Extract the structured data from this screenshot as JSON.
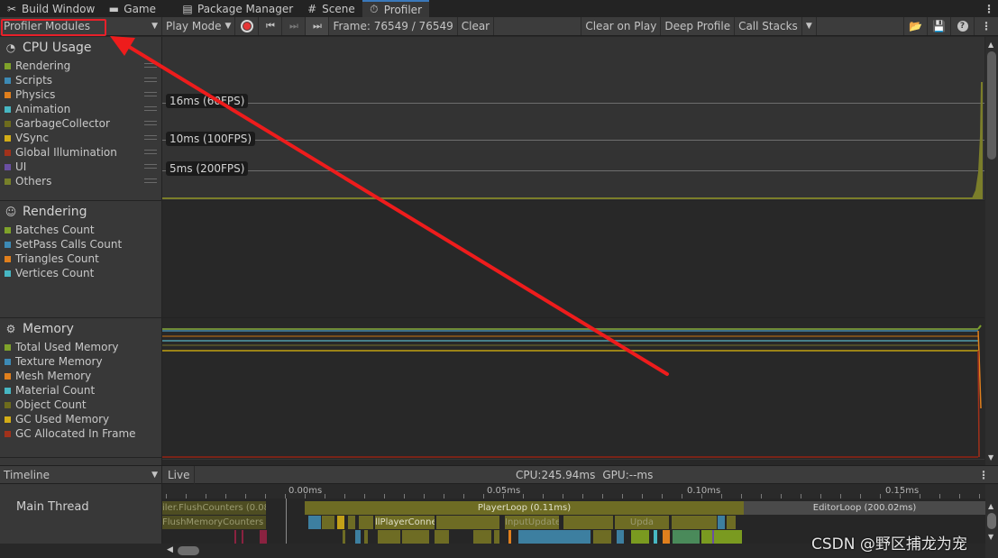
{
  "tabs": [
    {
      "label": "Build Window",
      "icon": "tools-icon"
    },
    {
      "label": "Game",
      "icon": "gamepad-icon"
    },
    {
      "label": "Package Manager",
      "icon": "package-icon"
    },
    {
      "label": "Scene",
      "icon": "hash-icon"
    },
    {
      "label": "Profiler",
      "icon": "stopwatch-icon",
      "active": true
    }
  ],
  "toolbar": {
    "modules_label": "Profiler Modules",
    "play_mode_label": "Play Mode",
    "frame_label": "Frame: 76549 / 76549",
    "clear_label": "Clear",
    "clear_on_play_label": "Clear on Play",
    "deep_profile_label": "Deep Profile",
    "call_stacks_label": "Call Stacks"
  },
  "modules": {
    "cpu": {
      "title": "CPU Usage",
      "items": [
        {
          "label": "Rendering",
          "color": "#7fa22a"
        },
        {
          "label": "Scripts",
          "color": "#3d8ab5"
        },
        {
          "label": "Physics",
          "color": "#e07f1d"
        },
        {
          "label": "Animation",
          "color": "#47b7c3"
        },
        {
          "label": "GarbageCollector",
          "color": "#6e6c1d"
        },
        {
          "label": "VSync",
          "color": "#d2ac17"
        },
        {
          "label": "Global Illumination",
          "color": "#a1311b"
        },
        {
          "label": "UI",
          "color": "#6a4fa3"
        },
        {
          "label": "Others",
          "color": "#77802a"
        }
      ],
      "fps_markers": [
        "16ms (60FPS)",
        "10ms (100FPS)",
        "5ms (200FPS)"
      ]
    },
    "rendering": {
      "title": "Rendering",
      "items": [
        {
          "label": "Batches Count",
          "color": "#7fa22a"
        },
        {
          "label": "SetPass Calls Count",
          "color": "#3d8ab5"
        },
        {
          "label": "Triangles Count",
          "color": "#e07f1d"
        },
        {
          "label": "Vertices Count",
          "color": "#47b7c3"
        }
      ]
    },
    "memory": {
      "title": "Memory",
      "items": [
        {
          "label": "Total Used Memory",
          "color": "#7fa22a"
        },
        {
          "label": "Texture Memory",
          "color": "#3d8ab5"
        },
        {
          "label": "Mesh Memory",
          "color": "#e07f1d"
        },
        {
          "label": "Material Count",
          "color": "#47b7c3"
        },
        {
          "label": "Object Count",
          "color": "#6e6c1d"
        },
        {
          "label": "GC Used Memory",
          "color": "#d2ac17"
        },
        {
          "label": "GC Allocated In Frame",
          "color": "#a1311b"
        }
      ]
    }
  },
  "bottom": {
    "view_label": "Timeline",
    "live_label": "Live",
    "cpu_stat": "CPU:245.94ms",
    "gpu_stat": "GPU:--ms",
    "thread_label": "Main Thread",
    "ruler": [
      "0.00ms",
      "0.05ms",
      "0.10ms",
      "0.15ms"
    ],
    "blocks": {
      "flush_counters": "iler.FlushCounters (0.08",
      "flush_memory": "FlushMemoryCounters (",
      "player_loop": "PlayerLoop (0.11ms)",
      "player_conn": "llPlayerConne",
      "input": "InputUpdate",
      "update": "Upda",
      "editor_loop": "EditorLoop (200.02ms)"
    }
  },
  "watermark": "CSDN @野区捕龙为宠"
}
